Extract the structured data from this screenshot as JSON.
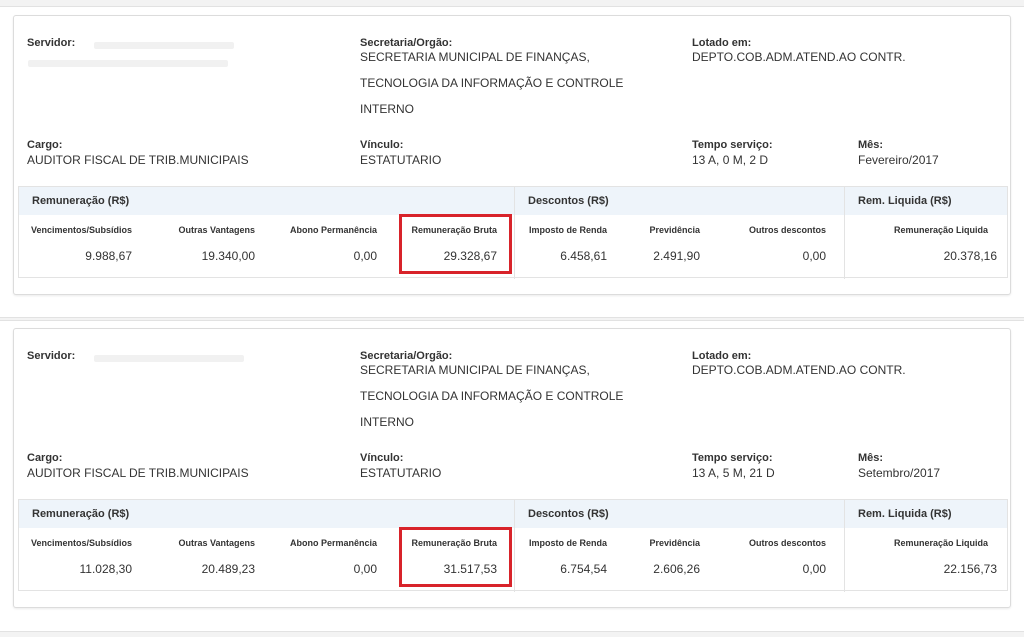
{
  "labels": {
    "servidor": "Servidor:",
    "secretaria": "Secretaria/Orgão:",
    "lotado": "Lotado em:",
    "cargo": "Cargo:",
    "vinculo": "Vínculo:",
    "tempo": "Tempo serviço:",
    "mes": "Mês:",
    "remuneracao": "Remuneração (R$)",
    "descontos": "Descontos (R$)",
    "rem_liquida": "Rem. Liquida (R$)",
    "vencimentos": "Vencimentos/Subsídios",
    "outras_vantagens": "Outras Vantagens",
    "abono": "Abono Permanência",
    "rem_bruta": "Remuneração Bruta",
    "imposto": "Imposto de Renda",
    "previdencia": "Previdência",
    "outros_descontos": "Outros descontos",
    "rem_liquida_col": "Remuneração Liquida"
  },
  "records": [
    {
      "secretaria_lines": [
        "SECRETARIA MUNICIPAL DE FINANÇAS,",
        "TECNOLOGIA DA INFORMAÇÃO E CONTROLE",
        "INTERNO"
      ],
      "lotado": "DEPTO.COB.ADM.ATEND.AO CONTR.",
      "cargo": "AUDITOR FISCAL DE TRIB.MUNICIPAIS",
      "vinculo": "ESTATUTARIO",
      "tempo": "13 A, 0 M, 2 D",
      "mes": "Fevereiro/2017",
      "vencimentos": "9.988,67",
      "outras_vantagens": "19.340,00",
      "abono": "0,00",
      "rem_bruta": "29.328,67",
      "imposto": "6.458,61",
      "previdencia": "2.491,90",
      "outros_descontos": "0,00",
      "rem_liquida": "20.378,16"
    },
    {
      "secretaria_lines": [
        "SECRETARIA MUNICIPAL DE FINANÇAS,",
        "TECNOLOGIA DA INFORMAÇÃO E CONTROLE",
        "INTERNO"
      ],
      "lotado": "DEPTO.COB.ADM.ATEND.AO CONTR.",
      "cargo": "AUDITOR FISCAL DE TRIB.MUNICIPAIS",
      "vinculo": "ESTATUTARIO",
      "tempo": "13 A, 5 M, 21 D",
      "mes": "Setembro/2017",
      "vencimentos": "11.028,30",
      "outras_vantagens": "20.489,23",
      "abono": "0,00",
      "rem_bruta": "31.517,53",
      "imposto": "6.754,54",
      "previdencia": "2.606,26",
      "outros_descontos": "0,00",
      "rem_liquida": "22.156,73"
    }
  ],
  "colors": {
    "highlight": "#d8232a",
    "table_header": "#eef4fa"
  }
}
